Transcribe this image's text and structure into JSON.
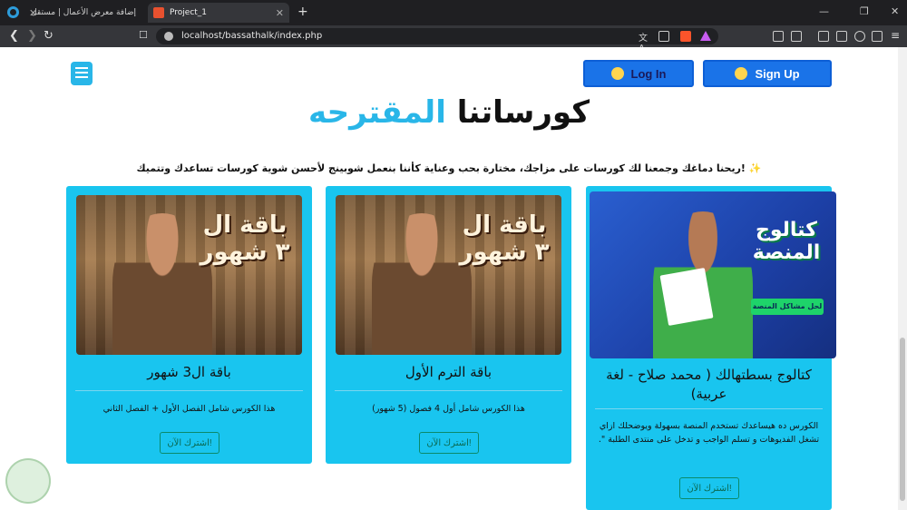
{
  "browser": {
    "tab1_title": "إضافة معرض الأعمال | مستقل",
    "tab2_title": "Project_1",
    "url": "localhost/bassathalk/index.php"
  },
  "header": {
    "login_label": "Log In",
    "signup_label": "Sign Up"
  },
  "hero": {
    "title_main": "كورساتنا",
    "title_accent": "المقترحه",
    "intro": "✨ !ريحنا دماغك وجمعنا لك كورسات على مزاجك، مختارة بحب وعناية كأننا بنعمل شوبينج لأحسن شوية كورسات تساعدك وتتميك"
  },
  "cards": [
    {
      "title": "باقة ال3 شهور",
      "desc": "هذا الكورس شامل الفصل الأول + الفصل الثاني",
      "button": "اشترك الآن!",
      "poster_title": "باقة ال ٣ شهور"
    },
    {
      "title": "باقة الترم الأول",
      "desc": "هذا الكورس شامل أول 4 فصول (5 شهور)",
      "button": "اشترك الآن!",
      "poster_title": "باقة ال ٣ شهور"
    },
    {
      "title": "كتالوج بسطتهالك ( محمد صلاح - لغة عربية)",
      "desc": "الكورس ده هيساعدك تستخدم المنصة بسهولة ويوضحلك ازاي تشغل الفديوهات و تسلم الواجب و تدخل على منتدى الطلبة \".",
      "button": "اشترك الآن!",
      "poster_title": "كتالوج المنصة",
      "poster_tag": "لحل مشاكل المنصة"
    }
  ]
}
